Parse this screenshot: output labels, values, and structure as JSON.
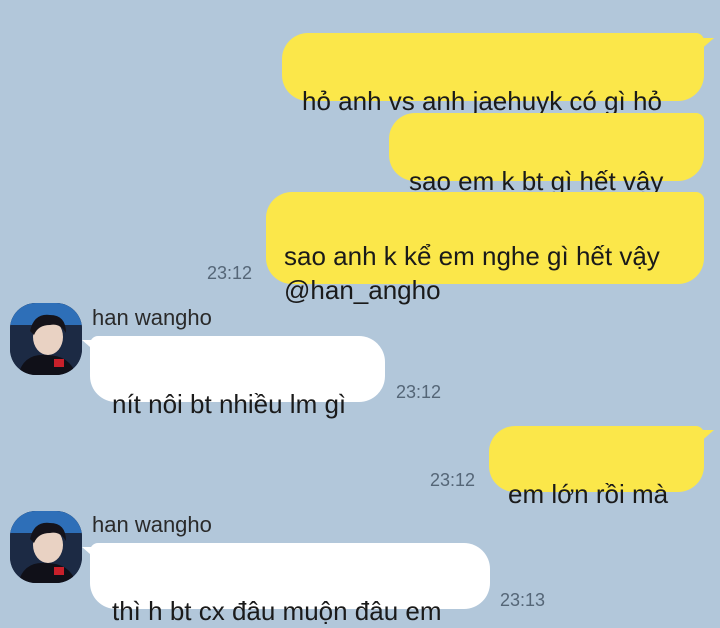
{
  "chat": {
    "messages": [
      {
        "direction": "outgoing",
        "text": "hỏ anh vs anh jaehuyk có gì hỏ"
      },
      {
        "direction": "outgoing",
        "text": "sao em k bt gì hết vậy"
      },
      {
        "direction": "outgoing",
        "text": "sao anh k kể em nghe gì hết vậy\n@han_angho",
        "time": "23:12"
      },
      {
        "direction": "incoming",
        "sender": "han wangho",
        "text": "nít nôi bt nhiều lm gì",
        "time": "23:12"
      },
      {
        "direction": "outgoing",
        "text": "em lớn rồi mà",
        "time": "23:12"
      },
      {
        "direction": "incoming",
        "sender": "han wangho",
        "text": "thì h bt cx đâu muộn đâu em",
        "time": "23:13"
      }
    ]
  },
  "colors": {
    "background": "#b2c7da",
    "outgoing_bubble": "#fbe74a",
    "incoming_bubble": "#ffffff"
  },
  "icons": {
    "avatar": "avatar-photo-icon"
  }
}
